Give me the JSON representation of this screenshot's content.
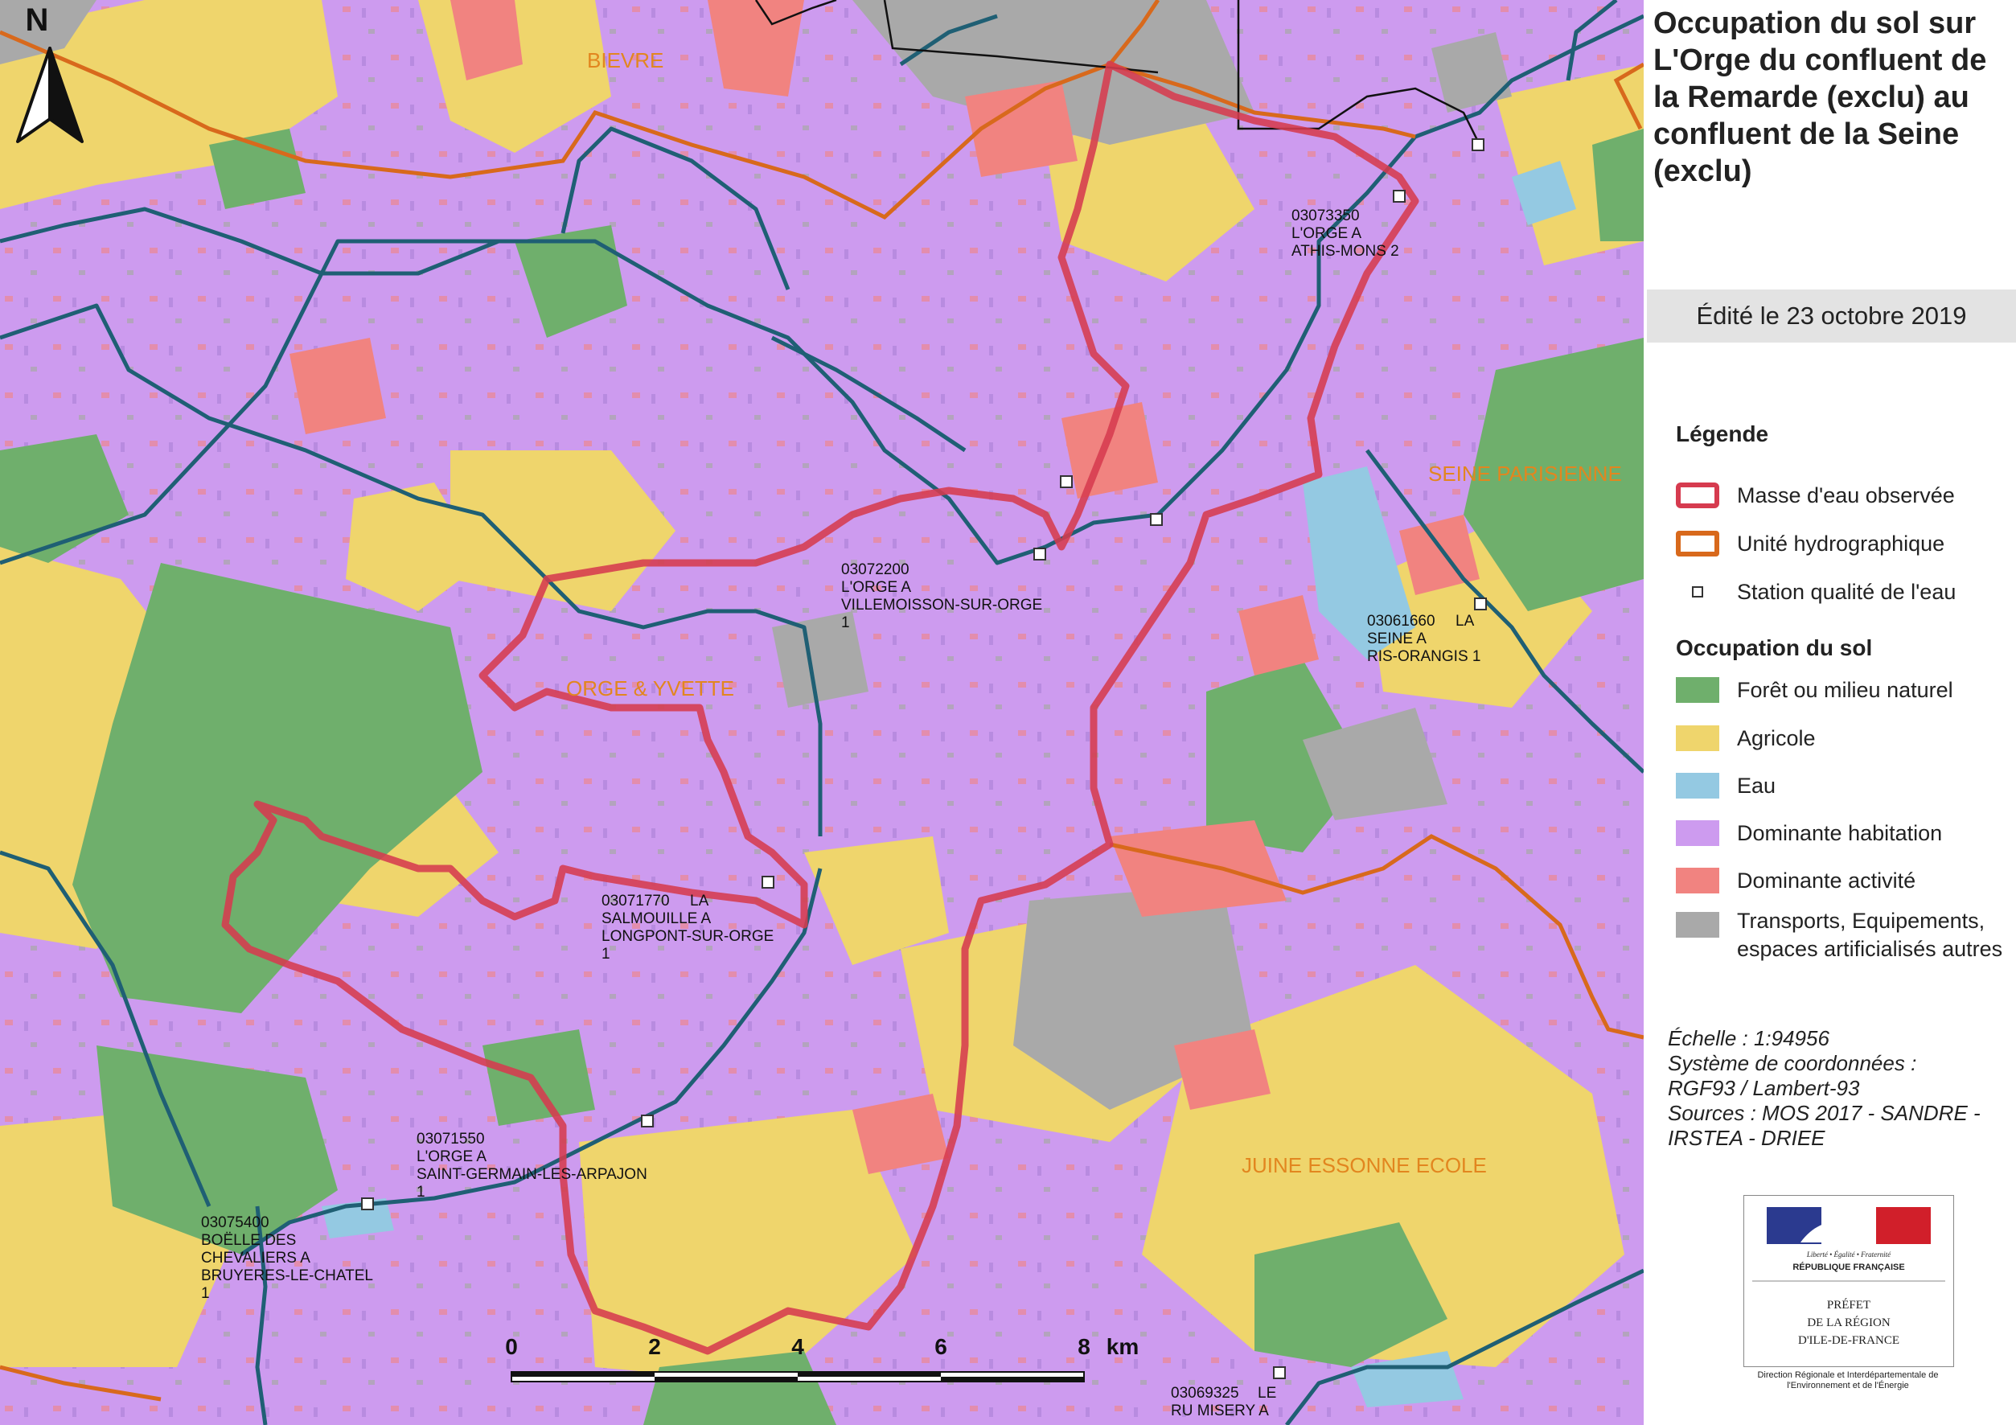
{
  "map": {
    "north_label": "N",
    "zones": [
      "BIEVRE",
      "ORGE & YVETTE",
      "SEINE PARISIENNE",
      "JUINE ESSONNE ECOLE"
    ],
    "stations": [
      {
        "code": "03073350",
        "lines": [
          "L'ORGE A",
          "ATHIS-MONS 2"
        ]
      },
      {
        "code": "03072200",
        "lines": [
          "L'ORGE A",
          "VILLEMOISSON-SUR-ORGE",
          "1"
        ]
      },
      {
        "code": "03061660",
        "first_suffix": "LA",
        "lines": [
          "SEINE A",
          "RIS-ORANGIS 1"
        ]
      },
      {
        "code": "03071770",
        "first_suffix": "LA",
        "lines": [
          "SALMOUILLE A",
          "LONGPONT-SUR-ORGE",
          "1"
        ]
      },
      {
        "code": "03071550",
        "lines": [
          "L'ORGE A",
          "SAINT-GERMAIN-LES-ARPAJON",
          "1"
        ]
      },
      {
        "code": "03075400",
        "lines": [
          "BOËLLE DES",
          "CHEVALIERS A",
          "BRUYERES-LE-CHATEL",
          "1"
        ]
      },
      {
        "code": "03069325",
        "first_suffix": "LE",
        "lines": [
          "RU MISERY A"
        ]
      }
    ],
    "scale_ticks": [
      "0",
      "2",
      "4",
      "6",
      "8"
    ],
    "scale_unit": "km",
    "colors": {
      "forest": "#6faf6c",
      "agricultural": "#efd56c",
      "water": "#94c9e2",
      "housing": "#cd9bef",
      "activity": "#f18380",
      "transport": "#a9a9a9",
      "water_body": "#d63b4f",
      "hydro_unit": "#d8691c",
      "river": "#1f5f74"
    }
  },
  "panel": {
    "title": "Occupation du sol sur L'Orge du confluent de la Remarde (exclu) au confluent de la Seine (exclu)",
    "edited": "Édité le 23 octobre 2019",
    "legend_title": "Légende",
    "legend_items": [
      {
        "label": "Masse d'eau observée",
        "icon": "red-outline-box"
      },
      {
        "label": "Unité hydrographique",
        "icon": "orange-outline-box"
      },
      {
        "label": "Station qualité de l'eau",
        "icon": "small-square"
      }
    ],
    "landuse_title": "Occupation du sol",
    "landuse_items": [
      {
        "label": "Forêt ou milieu naturel",
        "color": "#6faf6c"
      },
      {
        "label": "Agricole",
        "color": "#efd56c"
      },
      {
        "label": "Eau",
        "color": "#94c9e2"
      },
      {
        "label": "Dominante habitation",
        "color": "#cd9bef"
      },
      {
        "label": "Dominante activité",
        "color": "#f18380"
      },
      {
        "label": "Transports, Equipements, espaces artificialisés  autres",
        "color": "#a9a9a9"
      }
    ],
    "meta": [
      "Échelle :  1:94956",
      "Système de coordonnées :",
      "RGF93 / Lambert-93",
      "Sources : MOS 2017 - SANDRE -",
      "IRSTEA - DRIEE"
    ],
    "logo": {
      "motto": "Liberté • Égalité • Fraternité",
      "republic": "RÉPUBLIQUE FRANÇAISE",
      "prefet_lines": [
        "PRÉFET",
        "DE LA RÉGION",
        "D'ILE-DE-FRANCE"
      ],
      "caption": "Direction Régionale et Interdépartementale de l'Environnement et de l'Énergie"
    }
  }
}
